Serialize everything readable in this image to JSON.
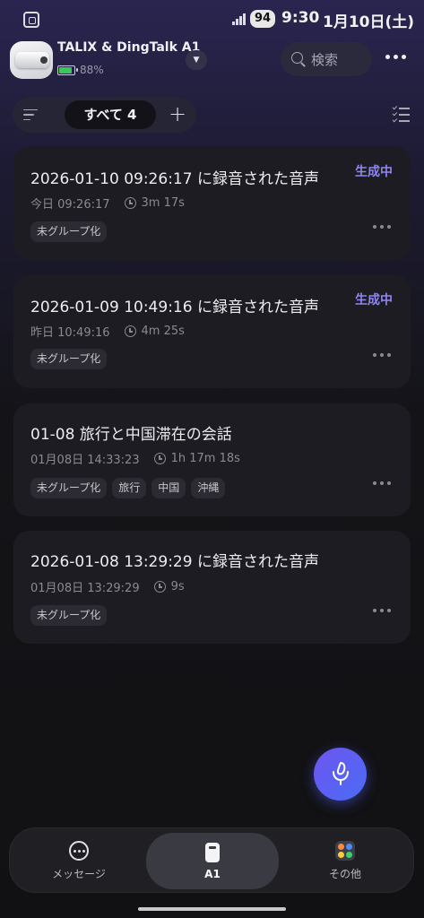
{
  "status_bar": {
    "battery": "94",
    "time": "9:30",
    "date": "1月10日(土)"
  },
  "header": {
    "device_name": "TALIX & DingTalk A1",
    "device_battery": "88%",
    "device_battery_level": 0.88,
    "search_placeholder": "検索"
  },
  "filter": {
    "active_tab": "すべて 4",
    "add_symbol": "+"
  },
  "recordings": [
    {
      "title": "2026-01-10 09:26:17 に録音された音声",
      "status": "生成中",
      "datetime": "今日 09:26:17",
      "duration": "3m 17s",
      "tags": [
        "未グループ化"
      ]
    },
    {
      "title": "2026-01-09 10:49:16 に録音された音声",
      "status": "生成中",
      "datetime": "昨日 10:49:16",
      "duration": "4m 25s",
      "tags": [
        "未グループ化"
      ]
    },
    {
      "title": "01-08 旅行と中国滞在の会話",
      "status": "",
      "datetime": "01月08日 14:33:23",
      "duration": "1h 17m 18s",
      "tags": [
        "未グループ化",
        "旅行",
        "中国",
        "沖縄"
      ]
    },
    {
      "title": "2026-01-08 13:29:29 に録音された音声",
      "status": "",
      "datetime": "01月08日 13:29:29",
      "duration": "9s",
      "tags": [
        "未グループ化"
      ]
    }
  ],
  "bottom_nav": {
    "items": [
      {
        "label": "メッセージ",
        "icon": "message-icon"
      },
      {
        "label": "A1",
        "icon": "device-icon"
      },
      {
        "label": "その他",
        "icon": "apps-icon"
      }
    ],
    "active": "A1"
  },
  "colors": {
    "accent": "#8f86f0",
    "fab_gradient_start": "#6f55f0",
    "fab_gradient_end": "#4a6cf5",
    "card_bg": "#1d1c22"
  }
}
